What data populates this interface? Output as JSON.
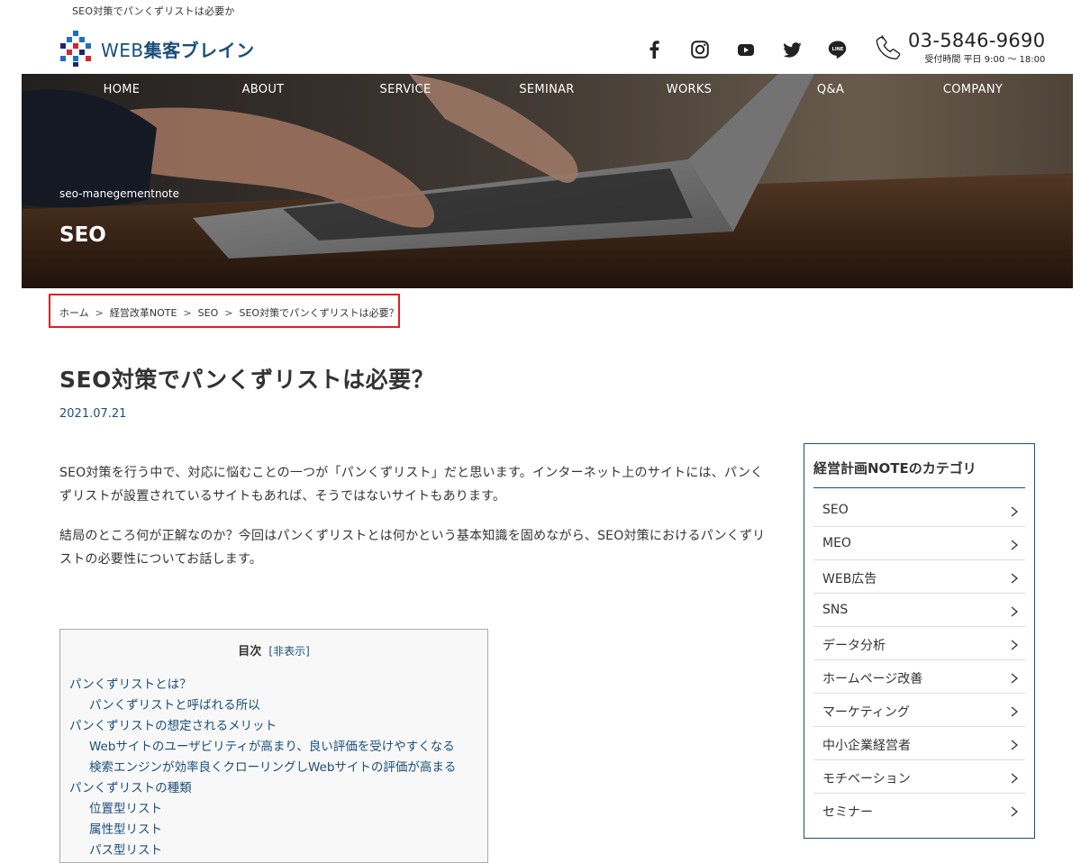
{
  "header": {
    "tagline": "SEO対策でパンくずリストは必要か",
    "logo": {
      "text_latin": "WEB",
      "text_jp": "集客ブレイン",
      "icon": "pixel-mosaic-logo-icon"
    },
    "social_icons": [
      "facebook-icon",
      "instagram-icon",
      "youtube-icon",
      "twitter-icon",
      "line-icon"
    ],
    "line_icon_text": "LINE",
    "phone": {
      "number": "03-5846-9690",
      "hours": "受付時間 平日 9:00 〜 18:00",
      "icon": "phone-icon"
    }
  },
  "nav": {
    "items": [
      "HOME",
      "ABOUT",
      "SERVICE",
      "SEMINAR",
      "WORKS",
      "Q&A",
      "COMPANY"
    ]
  },
  "hero": {
    "subtitle": "seo-manegementnote",
    "title": "SEO"
  },
  "breadcrumb": {
    "items": [
      "ホーム",
      "経営改革NOTE",
      "SEO",
      "SEO対策でパンくずリストは必要？"
    ],
    "separator": ">"
  },
  "article": {
    "title": "SEO対策でパンくずリストは必要？",
    "date": "2021.07.21",
    "paragraphs": [
      "SEO対策を行う中で、対応に悩むことの一つが「パンくずリスト」だと思います。インターネット上のサイトには、パンくずリストが設置されているサイトもあれば、そうではないサイトもあります。",
      "結局のところ何が正解なのか？今回はパンくずリストとは何かという基本知識を固めながら、SEO対策におけるパンくずリストの必要性についてお話します。"
    ]
  },
  "toc": {
    "title": "目次",
    "toggle_open": "[",
    "toggle_label": "非表示",
    "toggle_close": "]",
    "items": [
      {
        "label": "パンくずリストとは？",
        "level": 1
      },
      {
        "label": "パンくずリストと呼ばれる所以",
        "level": 2
      },
      {
        "label": "パンくずリストの想定されるメリット",
        "level": 1
      },
      {
        "label": "Webサイトのユーザビリティが高まり、良い評価を受けやすくなる",
        "level": 2
      },
      {
        "label": "検索エンジンが効率良くクローリングしWebサイトの評価が高まる",
        "level": 2
      },
      {
        "label": "パンくずリストの種類",
        "level": 1
      },
      {
        "label": "位置型リスト",
        "level": 2
      },
      {
        "label": "属性型リスト",
        "level": 2
      },
      {
        "label": "パス型リスト",
        "level": 2
      }
    ]
  },
  "sidebar": {
    "title": "経営計画NOTEのカテゴリ",
    "categories": [
      "SEO",
      "MEO",
      "WEB広告",
      "SNS",
      "データ分析",
      "ホームページ改善",
      "マーケティング",
      "中小企業経営者",
      "モチベーション",
      "セミナー"
    ],
    "chevron_icon": "chevron-right-icon"
  },
  "colors": {
    "brand_navy": "#1b4f7a",
    "highlight_red": "#e02020",
    "text": "#333333",
    "logo_blue": "#1e6fc0",
    "logo_red": "#d9232d",
    "logo_navy": "#1a2b6b"
  }
}
